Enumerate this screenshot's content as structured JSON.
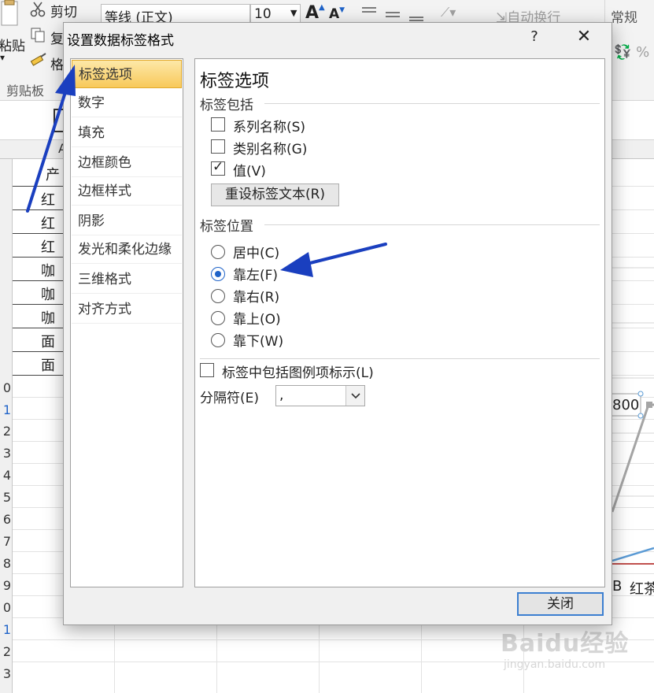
{
  "ribbon": {
    "cut": "剪切",
    "copy": "复",
    "paste": "粘贴",
    "format_painter": "格",
    "clipboard_group": "剪贴板",
    "font_name": "等线 (正文)",
    "font_size": "10",
    "wrap_text": "自动换行",
    "number_format": "常规"
  },
  "sheet": {
    "col_a": "A",
    "cells": [
      "产",
      "红",
      "红",
      "红",
      "咖",
      "咖",
      "咖",
      "面",
      "面"
    ],
    "row_numbers": [
      "0",
      "1",
      "2",
      "3",
      "4",
      "5",
      "6",
      "7",
      "8",
      "9",
      "0",
      "1",
      "2",
      "3"
    ],
    "chart_label_value": "800",
    "chart_axis_b": "B",
    "chart_axis_red": "红茶"
  },
  "dialog": {
    "title": "设置数据标签格式",
    "help": "?",
    "close_x": "✕",
    "nav": [
      "标签选项",
      "数字",
      "填充",
      "边框颜色",
      "边框样式",
      "阴影",
      "发光和柔化边缘",
      "三维格式",
      "对齐方式"
    ],
    "selected_nav": "标签选项",
    "section_title": "标签选项",
    "label_contains": {
      "group": "标签包括",
      "series_name": "系列名称(S)",
      "category_name": "类别名称(G)",
      "value": "值(V)",
      "series_checked": false,
      "category_checked": false,
      "value_checked": true
    },
    "reset_button": "重设标签文本(R)",
    "label_position": {
      "group": "标签位置",
      "options": [
        "居中(C)",
        "靠左(F)",
        "靠右(R)",
        "靠上(O)",
        "靠下(W)"
      ],
      "selected": "靠左(F)"
    },
    "legend_key": "标签中包括图例项标示(L)",
    "legend_key_checked": false,
    "separator_label": "分隔符(E)",
    "separator_value": ",",
    "close_button": "关闭"
  },
  "watermark": {
    "brand": "Baidu经验",
    "url": "jingyan.baidu.com"
  },
  "colors": {
    "selected_nav_fill": "#f8c95a",
    "radio_accent": "#1f63c8",
    "annotation_arrow": "#1a3fbf",
    "dialog_bg": "#f0f0f0"
  }
}
